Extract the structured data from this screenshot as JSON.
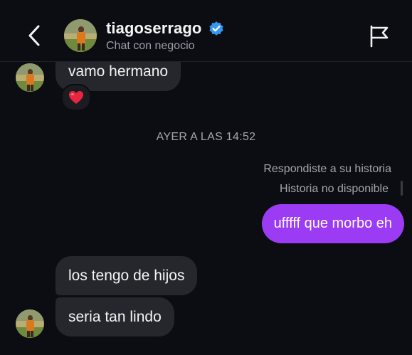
{
  "header": {
    "username": "tiagoserrago",
    "subtitle": "Chat con negocio",
    "back_icon": "chevron-left-icon",
    "verified_icon": "verified-badge-icon",
    "report_icon": "flag-icon"
  },
  "messages": {
    "m1": "vamo hermano",
    "m1_reaction": "❤️",
    "timestamp": "AYER A LAS 14:52",
    "reply_note": "Respondiste a su historia",
    "story_status": "Historia no disponible",
    "outgoing": "ufffff que morbo eh",
    "m2": "los tengo de hijos",
    "m3": "seria tan lindo"
  },
  "colors": {
    "background": "#0b0d12",
    "incoming_bubble": "#26272d",
    "outgoing_bubble": "#9b3cf4",
    "verified": "#3797f0"
  }
}
